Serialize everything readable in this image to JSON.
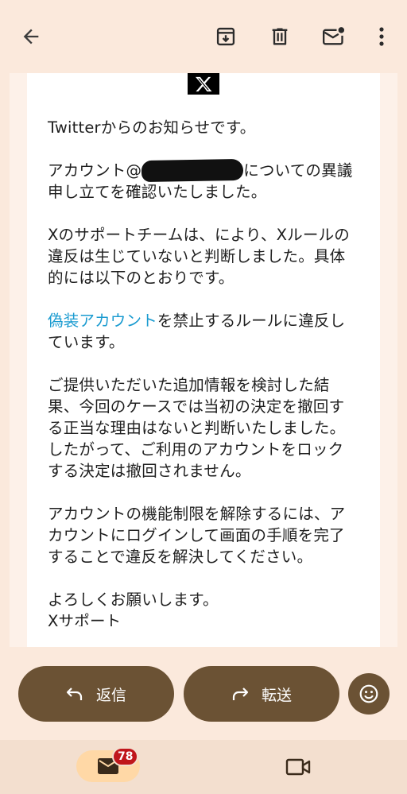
{
  "toolbar": {
    "back_icon": "arrow-left-icon",
    "archive_icon": "archive-icon",
    "delete_icon": "trash-icon",
    "mark_unread_icon": "mark-unread-icon",
    "more_icon": "more-vert-icon"
  },
  "email": {
    "logo_text": "X",
    "para1": "Twitterからのお知らせです。",
    "para2_before": "アカウント@",
    "para2_after": "についての異議申し立てを確認いたしました。",
    "para3": "Xのサポートチームは、により、Xルールの違反は生じていないと判断しました。具体的には以下のとおりです。",
    "para4_link": "偽装アカウント",
    "para4_rest": "を禁止するルールに違反しています。",
    "para5": "ご提供いただいた追加情報を検討した結果、今回のケースでは当初の決定を撤回する正当な理由はないと判断いたしました。したがって、ご利用のアカウントをロックする決定は撤回されません。",
    "para6": "アカウントの機能制限を解除するには、アカウントにログインして画面の手順を完了することで違反を解決してください。",
    "closing": "よろしくお願いします。",
    "signature": "Xサポート"
  },
  "actions": {
    "reply_label": "返信",
    "forward_label": "転送"
  },
  "nav": {
    "mail_badge": "78"
  },
  "colors": {
    "background": "#fbe9dc",
    "pill": "#6b5234",
    "link": "#1a9bd0",
    "badge": "#c0161b",
    "nav_active": "#ffd8a6"
  }
}
